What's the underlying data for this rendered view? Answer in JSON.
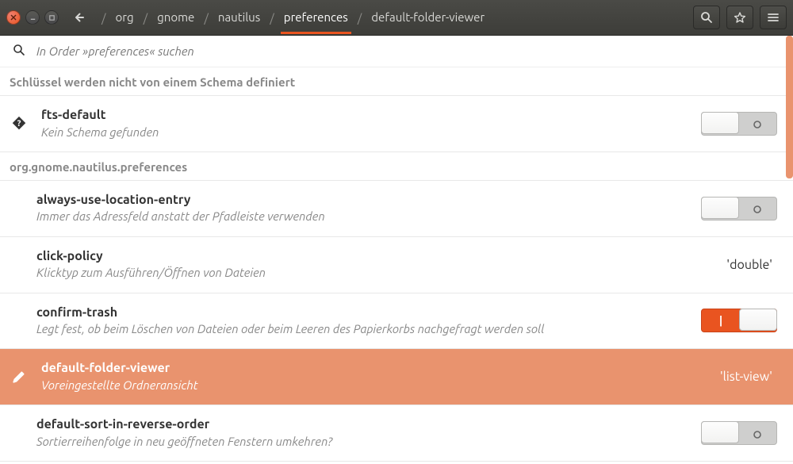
{
  "breadcrumb": [
    "org",
    "gnome",
    "nautilus",
    "preferences",
    "default-folder-viewer"
  ],
  "breadcrumb_active_index": 3,
  "search_placeholder": "In Order »preferences« suchen",
  "sections": [
    {
      "header": "Schlüssel werden nicht von einem Schema definiert",
      "rows": [
        {
          "title": "fts-default",
          "desc": "Kein Schema gefunden",
          "control_type": "switch",
          "switch_state": "off",
          "icon": "question"
        }
      ]
    },
    {
      "header": "org.gnome.nautilus.preferences",
      "rows": [
        {
          "title": "always-use-location-entry",
          "desc": "Immer das Adressfeld anstatt der Pfadleiste verwenden",
          "control_type": "switch",
          "switch_state": "off"
        },
        {
          "title": "click-policy",
          "desc": "Klicktyp zum Ausführen/Öffnen von Dateien",
          "control_type": "value",
          "value": "'double'"
        },
        {
          "title": "confirm-trash",
          "desc": "Legt fest, ob beim Löschen von Dateien oder beim Leeren des Papierkorbs nachgefragt werden soll",
          "control_type": "switch",
          "switch_state": "on"
        },
        {
          "title": "default-folder-viewer",
          "desc": "Voreingestellte Ordneransicht",
          "control_type": "value",
          "value": "'list-view'",
          "selected": true,
          "icon": "pencil"
        },
        {
          "title": "default-sort-in-reverse-order",
          "desc": "Sortierreihenfolge in neu geöffneten Fenstern umkehren?",
          "control_type": "switch",
          "switch_state": "off"
        }
      ]
    }
  ]
}
